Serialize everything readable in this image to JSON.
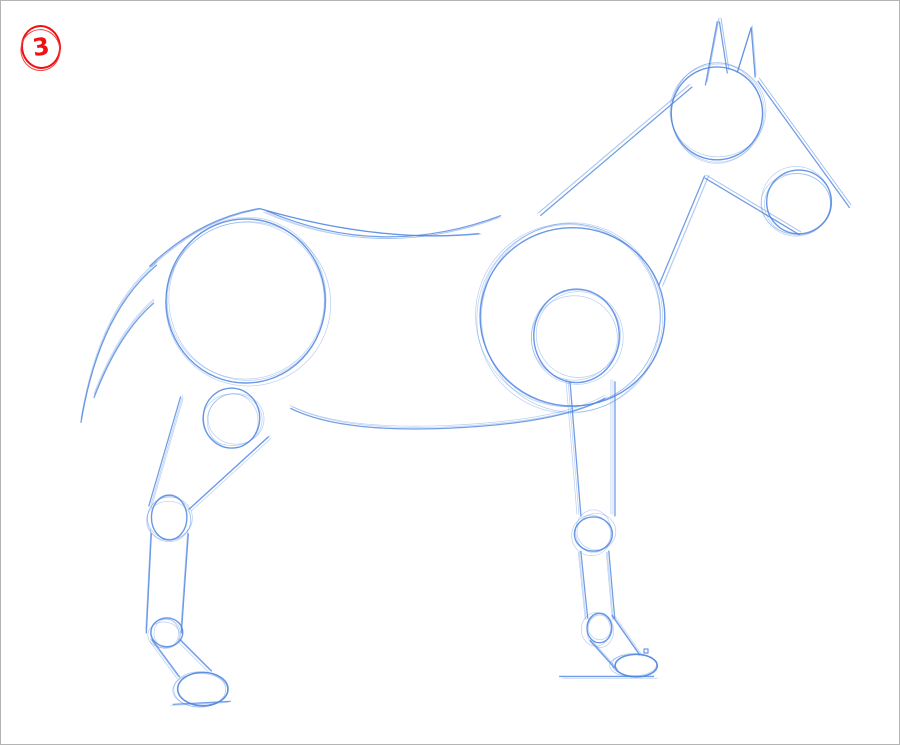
{
  "canvas": {
    "step_number": "3",
    "stroke_color": "#4f86e0",
    "badge_color": "#f01010"
  }
}
